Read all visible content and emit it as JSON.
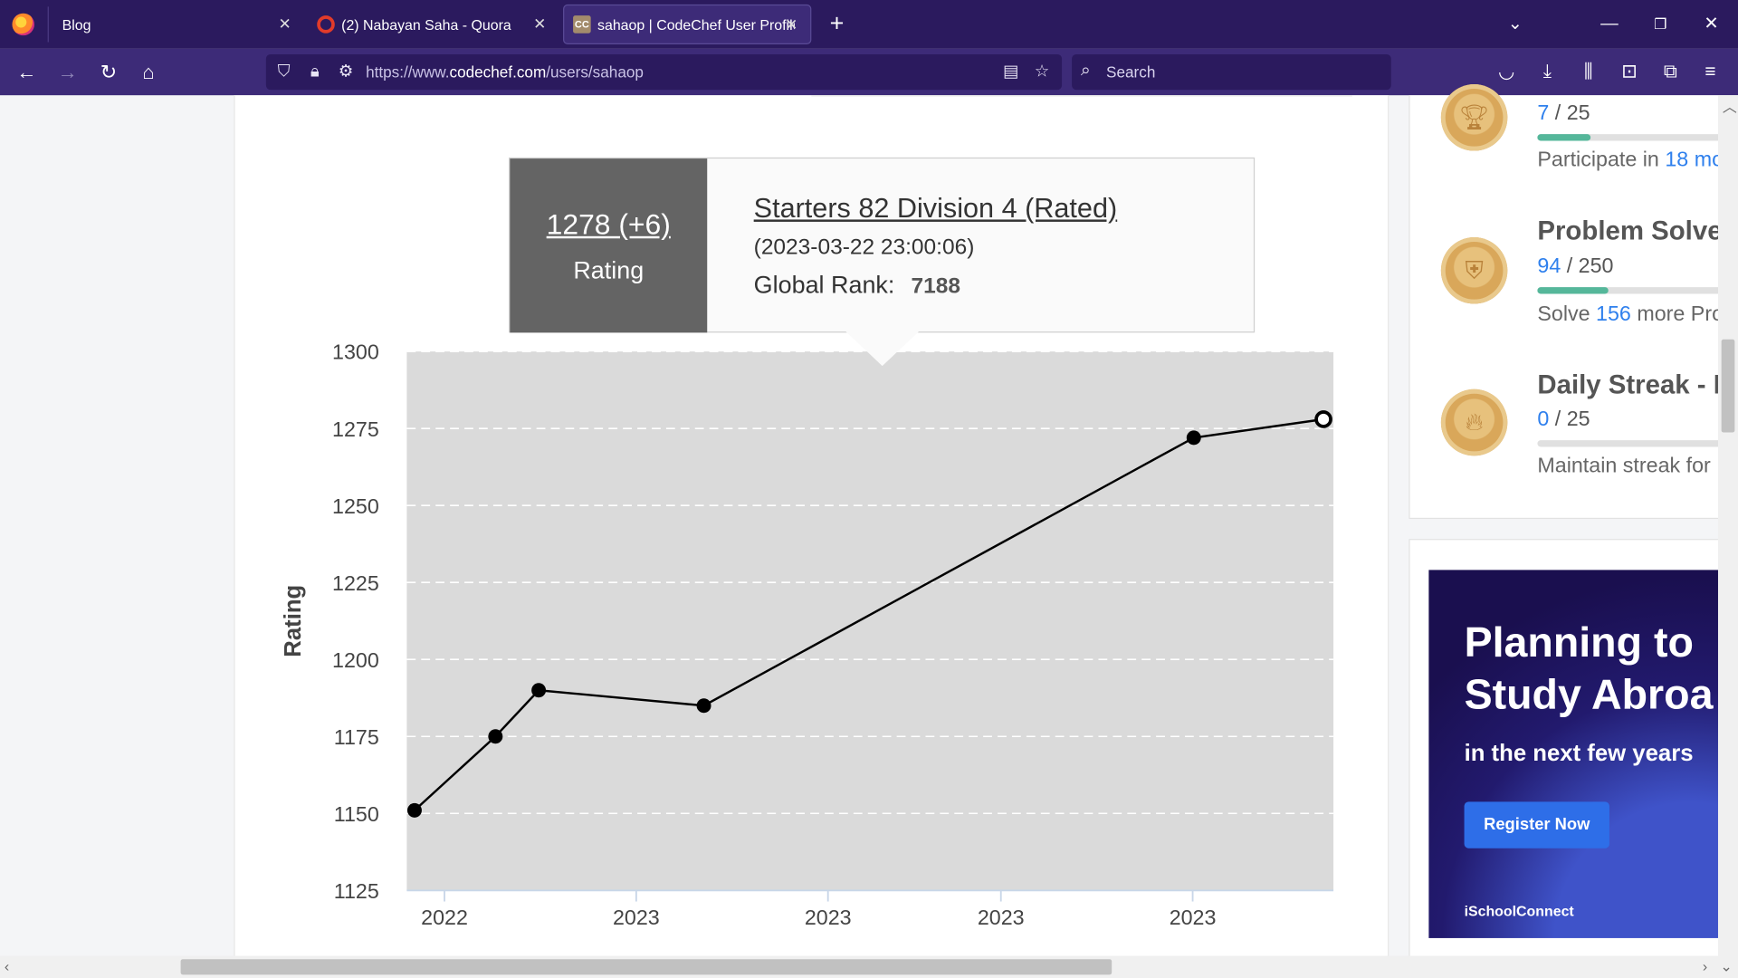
{
  "browser": {
    "tabs": [
      {
        "title": "Blog",
        "active": false
      },
      {
        "title": "(2) Nabayan Saha - Quora",
        "active": false
      },
      {
        "title": "sahaop | CodeChef User Profile",
        "active": true
      }
    ],
    "favicon_cc": "CC",
    "url_prefix": "https://www.",
    "url_domain": "codechef.com",
    "url_path": "/users/sahaop",
    "search_placeholder": "Search"
  },
  "tooltip": {
    "rating": "1278 (+6)",
    "rating_label": "Rating",
    "contest": "Starters 82 Division 4 (Rated)",
    "datetime": "(2023-03-22 23:00:06)",
    "rank_label": "Global Rank:",
    "rank_value": "7188"
  },
  "chart_data": {
    "type": "line",
    "ylabel": "Rating",
    "ylim": [
      1125,
      1300
    ],
    "yticks": [
      1125,
      1150,
      1175,
      1200,
      1225,
      1250,
      1275,
      1300
    ],
    "xticks": [
      "2022",
      "2023",
      "2023",
      "2023",
      "2023"
    ],
    "grid": true,
    "points": [
      {
        "x": "2022-11",
        "y": 1151
      },
      {
        "x": "2022-12",
        "y": 1175
      },
      {
        "x": "2023-01",
        "y": 1190
      },
      {
        "x": "2023-01",
        "y": 1185
      },
      {
        "x": "2023-03",
        "y": 1272
      },
      {
        "x": "2023-03-22",
        "y": 1278
      }
    ],
    "highlighted_index": 5,
    "colors": {
      "plot_bg": "#dadada",
      "line": "#000000",
      "point": "#000000"
    }
  },
  "badges": [
    {
      "icon": "trophy-icon",
      "title": "",
      "count": "7",
      "total": " / 25",
      "progress": 0.28,
      "desc_prefix": "Participate in ",
      "desc_num": "18",
      "desc_suffix": " mo"
    },
    {
      "icon": "shield-icon",
      "title": "Problem Solve",
      "count": "94",
      "total": " / 250",
      "progress": 0.376,
      "desc_prefix": "Solve ",
      "desc_num": "156",
      "desc_suffix": " more Pro"
    },
    {
      "icon": "flame-icon",
      "title": "Daily Streak - E",
      "count": "0",
      "total": " / 25",
      "progress": 0.0,
      "desc_prefix": "Maintain streak for",
      "desc_num": "",
      "desc_suffix": ""
    }
  ],
  "ad": {
    "line1": "Planning to",
    "line2": "Study Abroa",
    "line3": "in the next few years",
    "button": "Register Now",
    "brand": "iSchoolConnect"
  }
}
